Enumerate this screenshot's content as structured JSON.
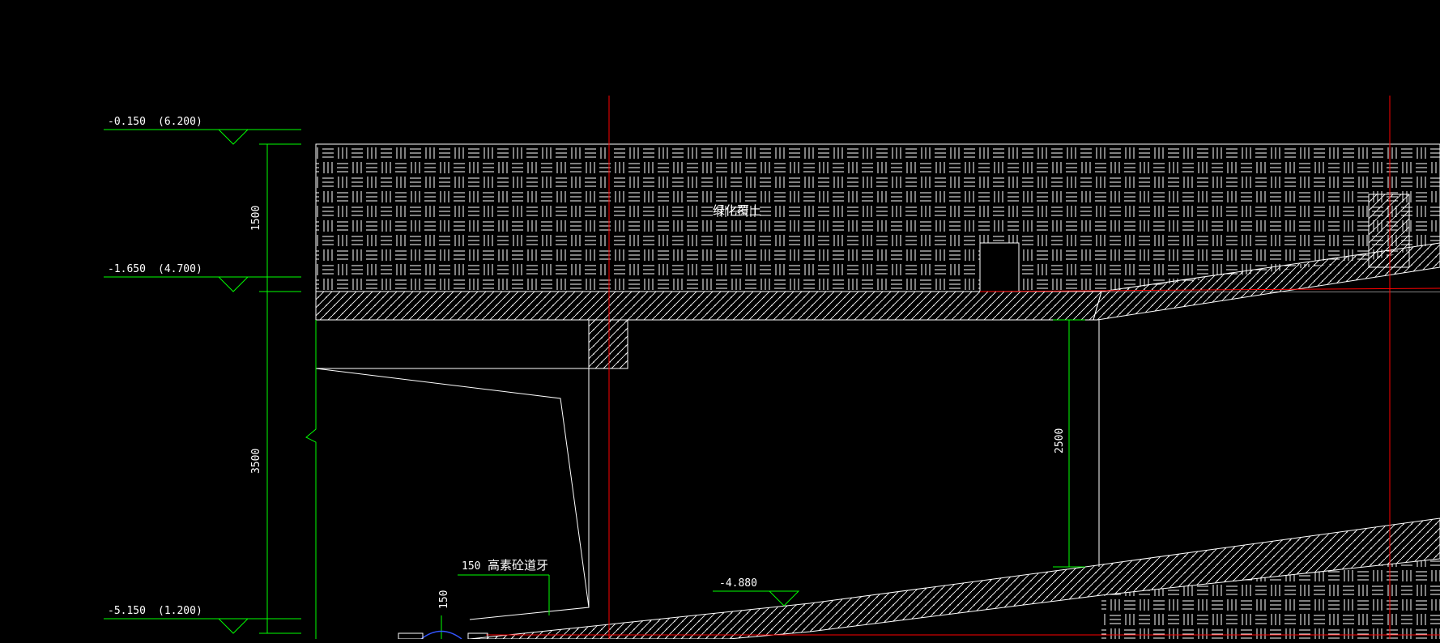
{
  "levels": [
    {
      "elev": "-0.150",
      "rel": "(6.200)"
    },
    {
      "elev": "-1.650",
      "rel": "(4.700)"
    },
    {
      "elev": "-5.150",
      "rel": "(1.200)"
    },
    {
      "elev": "-4.880"
    }
  ],
  "dimensions": {
    "d1500": "1500",
    "d3500": "3500",
    "d2500": "2500",
    "d150": "150"
  },
  "labels": {
    "soil": "绿化覆土",
    "curb_size": "150",
    "curb": "高素砼道牙"
  },
  "colors": {
    "background": "#000000",
    "linework": "#ffffff",
    "dimension": "#00ff00",
    "gridline": "#ff0000",
    "detail": "#3355ff"
  }
}
